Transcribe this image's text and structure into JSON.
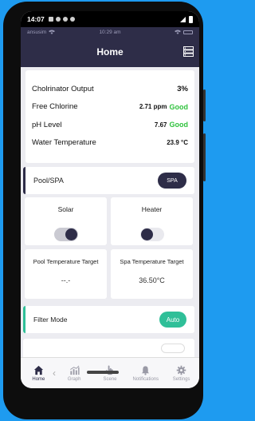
{
  "android_status": {
    "time": "14:07"
  },
  "ios_status": {
    "carrier": "ansusim",
    "time": "10:29 am"
  },
  "header": {
    "title": "Home"
  },
  "stats": [
    {
      "label": "Cholrinator Output",
      "value": "3%",
      "badge": ""
    },
    {
      "label": "Free Chlorine",
      "value": "2.71 ppm",
      "badge": "Good"
    },
    {
      "label": "pH Level",
      "value": "7.67",
      "badge": "Good"
    },
    {
      "label": "Water Temperature",
      "value": "23.9 °C",
      "badge": ""
    }
  ],
  "mode": {
    "label": "Pool/SPA",
    "button": "SPA"
  },
  "solar": {
    "label": "Solar",
    "state": "on"
  },
  "heater": {
    "label": "Heater",
    "state": "off"
  },
  "pool_temp": {
    "label": "Pool Temperature Target",
    "value": "--.-"
  },
  "spa_temp": {
    "label": "Spa Temperature Target",
    "value": "36.50°C"
  },
  "filter": {
    "label": "Filter Mode",
    "button": "Auto"
  },
  "tabs": [
    {
      "label": "Home",
      "icon": "home-icon"
    },
    {
      "label": "Graph",
      "icon": "graph-icon"
    },
    {
      "label": "Scene",
      "icon": "scene-icon"
    },
    {
      "label": "Notifications",
      "icon": "bell-icon"
    },
    {
      "label": "Settings",
      "icon": "gear-icon"
    }
  ],
  "colors": {
    "primary": "#2e2d48",
    "good": "#2fc23d",
    "accent": "#2fbf98",
    "background": "#1e9bf0"
  }
}
